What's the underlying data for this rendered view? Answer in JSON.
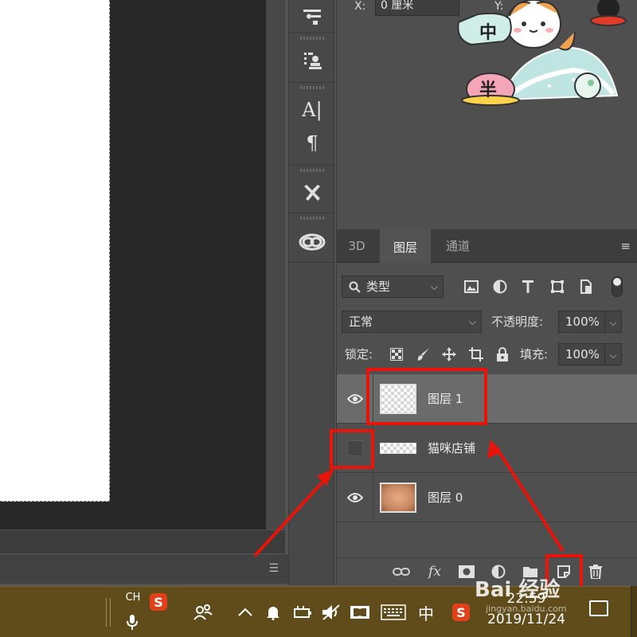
{
  "properties": {
    "x_label": "X:",
    "x_value": "0 厘米",
    "y_label": "Y:"
  },
  "sticker": {
    "badge_zhong": "中",
    "badge_ban": "半"
  },
  "layers_panel": {
    "tabs": [
      {
        "label": "3D",
        "active": false
      },
      {
        "label": "图层",
        "active": true
      },
      {
        "label": "通道",
        "active": false
      }
    ],
    "filter": {
      "value": "类型"
    },
    "blend_mode": {
      "value": "正常"
    },
    "opacity": {
      "label": "不透明度:",
      "value": "100%"
    },
    "lock": {
      "label": "锁定:"
    },
    "fill": {
      "label": "填充:",
      "value": "100%"
    },
    "layers": [
      {
        "name": "图层 1",
        "visible": true,
        "selected": true
      },
      {
        "name": "猫咪店铺",
        "visible": false,
        "selected": false
      },
      {
        "name": "图层 0",
        "visible": true,
        "selected": false
      }
    ],
    "footer_icons": [
      "link-icon",
      "fx-icon",
      "mask-icon",
      "adjustment-icon",
      "group-folder-icon",
      "new-layer-icon",
      "trash-icon"
    ],
    "fx_label": "fx"
  },
  "taskbar": {
    "ime_label": "CH",
    "ime_mode": "中",
    "sogou_label": "S",
    "time": "22:59",
    "date": "2019/11/24"
  },
  "watermark": {
    "text": "Bai 经验",
    "url": "jingyan.baidu.com"
  },
  "colors": {
    "annotation_red": "#e8140a",
    "panel_bg": "#4f4f4f",
    "selected_row": "#6b6b6b",
    "taskbar": "#5f4c1a"
  }
}
